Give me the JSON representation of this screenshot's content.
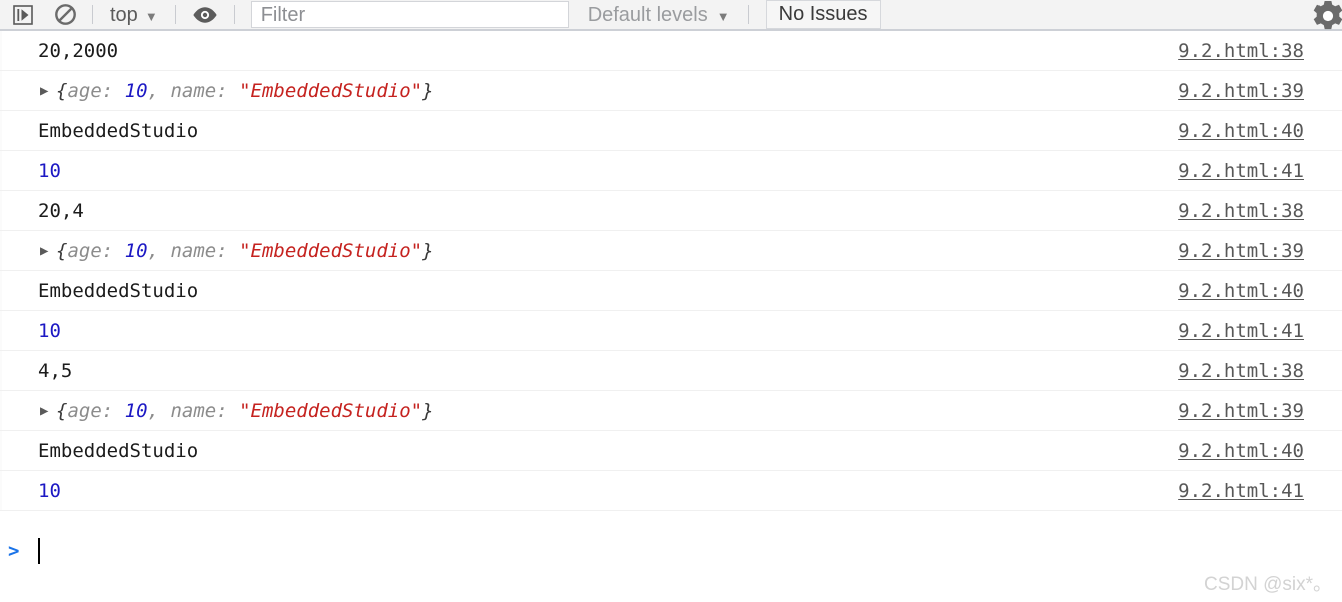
{
  "toolbar": {
    "resume_icon": "resume-script-icon",
    "clear_icon": "clear-console-icon",
    "context_label": "top",
    "context_caret": "▼",
    "eye_icon": "live-expression-eye-icon",
    "filter_placeholder": "Filter",
    "filter_value": "",
    "levels_label": "Default levels",
    "levels_caret": "▼",
    "issues_label": "No Issues",
    "settings_icon": "gear-icon"
  },
  "console": {
    "disclosure_glyph": "▶",
    "rows": [
      {
        "kind": "text",
        "text": "20,2000",
        "source": "9.2.html:38"
      },
      {
        "kind": "object",
        "expandable": true,
        "open_brace": "{",
        "key1": "age: ",
        "value1": "10",
        "comma": ", ",
        "key2": "name: ",
        "value2": "\"EmbeddedStudio\"",
        "close_brace": "}",
        "source": "9.2.html:39"
      },
      {
        "kind": "text",
        "text": "EmbeddedStudio",
        "source": "9.2.html:40"
      },
      {
        "kind": "number",
        "text": "10",
        "source": "9.2.html:41"
      },
      {
        "kind": "text",
        "text": "20,4",
        "source": "9.2.html:38"
      },
      {
        "kind": "object",
        "expandable": true,
        "open_brace": "{",
        "key1": "age: ",
        "value1": "10",
        "comma": ", ",
        "key2": "name: ",
        "value2": "\"EmbeddedStudio\"",
        "close_brace": "}",
        "source": "9.2.html:39"
      },
      {
        "kind": "text",
        "text": "EmbeddedStudio",
        "source": "9.2.html:40"
      },
      {
        "kind": "number",
        "text": "10",
        "source": "9.2.html:41"
      },
      {
        "kind": "text",
        "text": "4,5",
        "source": "9.2.html:38"
      },
      {
        "kind": "object",
        "expandable": true,
        "open_brace": "{",
        "key1": "age: ",
        "value1": "10",
        "comma": ", ",
        "key2": "name: ",
        "value2": "\"EmbeddedStudio\"",
        "close_brace": "}",
        "source": "9.2.html:39"
      },
      {
        "kind": "text",
        "text": "EmbeddedStudio",
        "source": "9.2.html:40"
      },
      {
        "kind": "number",
        "text": "10",
        "source": "9.2.html:41"
      }
    ]
  },
  "prompt": {
    "chevron": ">",
    "value": ""
  },
  "watermark": {
    "text": "CSDN @six*。"
  },
  "colors": {
    "toolbar_bg": "#f3f3f3",
    "toolbar_border": "#cdd0d6",
    "row_border": "#f0f0f0",
    "text_plain": "#1b1b1b",
    "number_blue": "#1c18c4",
    "string_red": "#c5221f",
    "key_gray": "#8c8c8c",
    "source_link": "#585858",
    "prompt_blue": "#1a73e8",
    "watermark_gray": "#d3d3d3"
  }
}
